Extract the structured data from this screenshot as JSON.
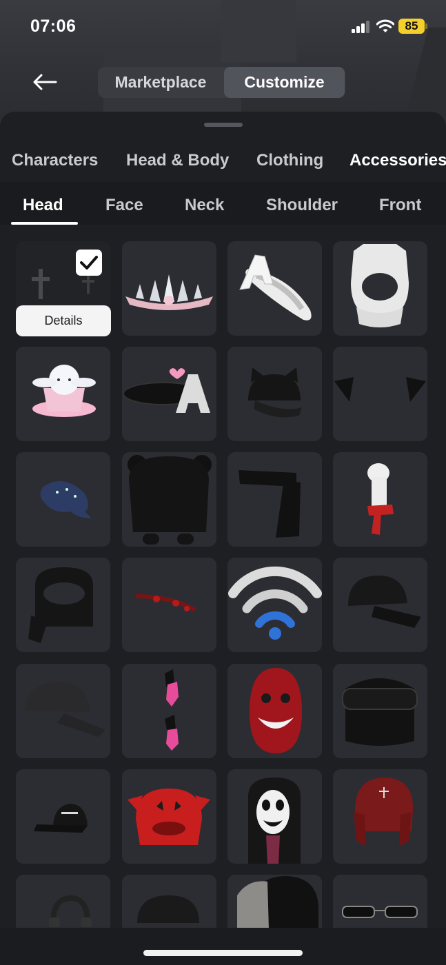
{
  "status_bar": {
    "time": "07:06",
    "battery": "85"
  },
  "header": {
    "back_icon": "arrow-left-icon",
    "segments": [
      "Marketplace",
      "Customize"
    ],
    "selected_segment": "Customize"
  },
  "category_tabs": [
    "Characters",
    "Head & Body",
    "Clothing",
    "Accessories"
  ],
  "active_category": "Accessories",
  "sub_tabs": [
    "Head",
    "Face",
    "Neck",
    "Shoulder",
    "Front"
  ],
  "active_sub_tab": "Head",
  "selected_item": {
    "details_label": "Details",
    "check_icon": "checkmark-icon"
  },
  "items": [
    "cross-crown-icon",
    "spiked-tiara-icon",
    "letter-a-clip-icon",
    "white-hood-icon",
    "bunny-teacup-icon",
    "black-clip-letter-a-icon",
    "cat-ear-cap-icon",
    "black-horns-icon",
    "whale-hat-icon",
    "bear-hood-icon",
    "black-scarf-icon",
    "llama-scarf-icon",
    "black-balaclava-icon",
    "red-thorn-headband-icon",
    "wifi-headband-icon",
    "black-cap-icon",
    "denim-cap-icon",
    "pink-tears-icon",
    "red-shark-hood-icon",
    "ski-mask-goggles-icon",
    "roblox-cap-icon",
    "red-cat-beanie-icon",
    "scary-face-mask-icon",
    "red-trapper-hat-icon",
    "headphones-icon",
    "black-beanie-icon",
    "fur-hood-icon",
    "glasses-icon"
  ],
  "colors": {
    "background": "#1b1c1f",
    "tile": "#2c2d32",
    "battery": "#f5cf2a",
    "accent_text": "#ffffff"
  }
}
